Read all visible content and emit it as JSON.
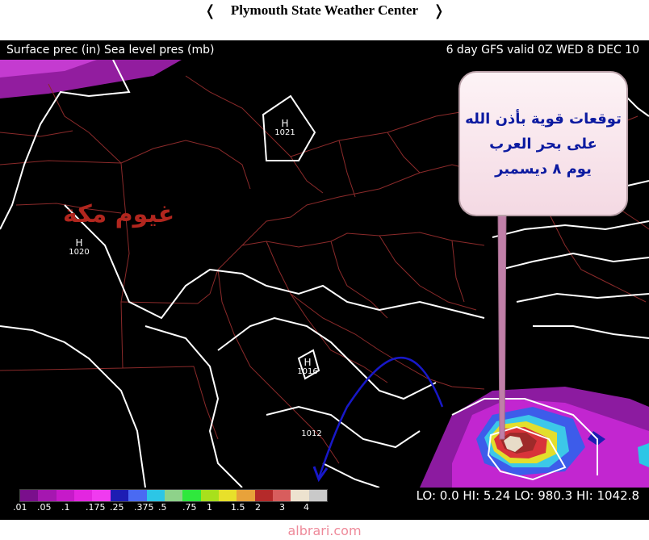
{
  "header": {
    "title": "Plymouth State Weather Center"
  },
  "subheader": {
    "left": "Surface prec (in) Sea level pres (mb)",
    "right": "6 day GFS valid 0Z WED 8 DEC 10"
  },
  "annotations": {
    "bubble_lines": [
      "توقعات قوية بأذن الله",
      "على بحر العرب",
      "يوم ٨ ديسمبر"
    ],
    "label": "غيوم مكة"
  },
  "pressure_centers": [
    {
      "symbol": "H",
      "value": "1021"
    },
    {
      "symbol": "H",
      "value": "1020"
    },
    {
      "symbol": "H",
      "value": "1016"
    },
    {
      "value": "1012"
    }
  ],
  "legend": {
    "ticks": [
      ".01",
      ".05",
      ".1",
      ".175",
      ".25",
      ".375",
      ".5",
      ".75",
      "1",
      "1.5",
      "2",
      "3",
      "4"
    ],
    "colors": [
      "#7a0f8c",
      "#a517b0",
      "#c61ac9",
      "#e326e0",
      "#f03bf0",
      "#1d1db3",
      "#4a6af2",
      "#2cc6e6",
      "#8ed28a",
      "#2fe83d",
      "#a8e01c",
      "#e8e02a",
      "#e8a23a",
      "#b52a2a",
      "#d85d5d",
      "#ede2cf",
      "#c9c9c9"
    ]
  },
  "stats": {
    "text": "LO:    0.0  HI:   5.24  LO: 980.3   HI: 1042.8"
  },
  "footer": {
    "text": "albrari.com"
  },
  "colors": {
    "border": "#8b2a2a",
    "isobar": "#ffffff",
    "arrow": "#1818c8",
    "bubble_text": "#0b1aa0",
    "label": "#b1261e"
  }
}
